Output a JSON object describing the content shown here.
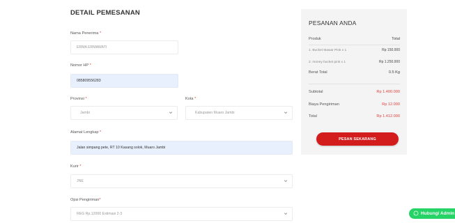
{
  "form": {
    "title": "DETAIL PEMESANAN",
    "recipient": {
      "label": "Nama Penerima",
      "value": "ERMA ERMAWATI"
    },
    "phone": {
      "label": "Nomor HP",
      "value": "085809556283"
    },
    "province": {
      "label": "Provinsi",
      "value": "Jambi"
    },
    "city": {
      "label": "Kota",
      "value": "Kabupaten Muaro Jambi"
    },
    "address": {
      "label": "Alamat Lengkap",
      "value": "Jalan simpang pete, RT 10 Kasang solok, Muaro Jambi"
    },
    "courier": {
      "label": "Kurir",
      "value": "JNE"
    },
    "shipping_option": {
      "label": "Opsi Pengiriman",
      "value": "REG Rp.12000 Estimasi 2-3"
    },
    "required_mark": "*"
  },
  "summary": {
    "title": "PESANAN ANDA",
    "product_header": "Produk",
    "total_header": "Total",
    "items": [
      {
        "name": "1. Bucket Mawar Pink x 1",
        "price": "Rp 150.000"
      },
      {
        "name": "2. money bucket pink x 1",
        "price": "Rp 1.250.000"
      }
    ],
    "weight_label": "Berat Total",
    "weight_value": "0.5 Kg",
    "subtotal_label": "Subtotal",
    "subtotal_value": "Rp 1.400.000",
    "shipping_label": "Biaya Pengiriman",
    "shipping_value": "Rp 12.000",
    "total_label": "Total",
    "total_value": "Rp 1.412.000",
    "order_button": "PESAN SEKARANG"
  },
  "whatsapp": {
    "label": "Hubungi Admin"
  },
  "colors": {
    "accent_red": "#e0443e",
    "button_red": "#d31c1c",
    "whatsapp_green": "#25d366",
    "filled_field": "#e8f0fe"
  }
}
